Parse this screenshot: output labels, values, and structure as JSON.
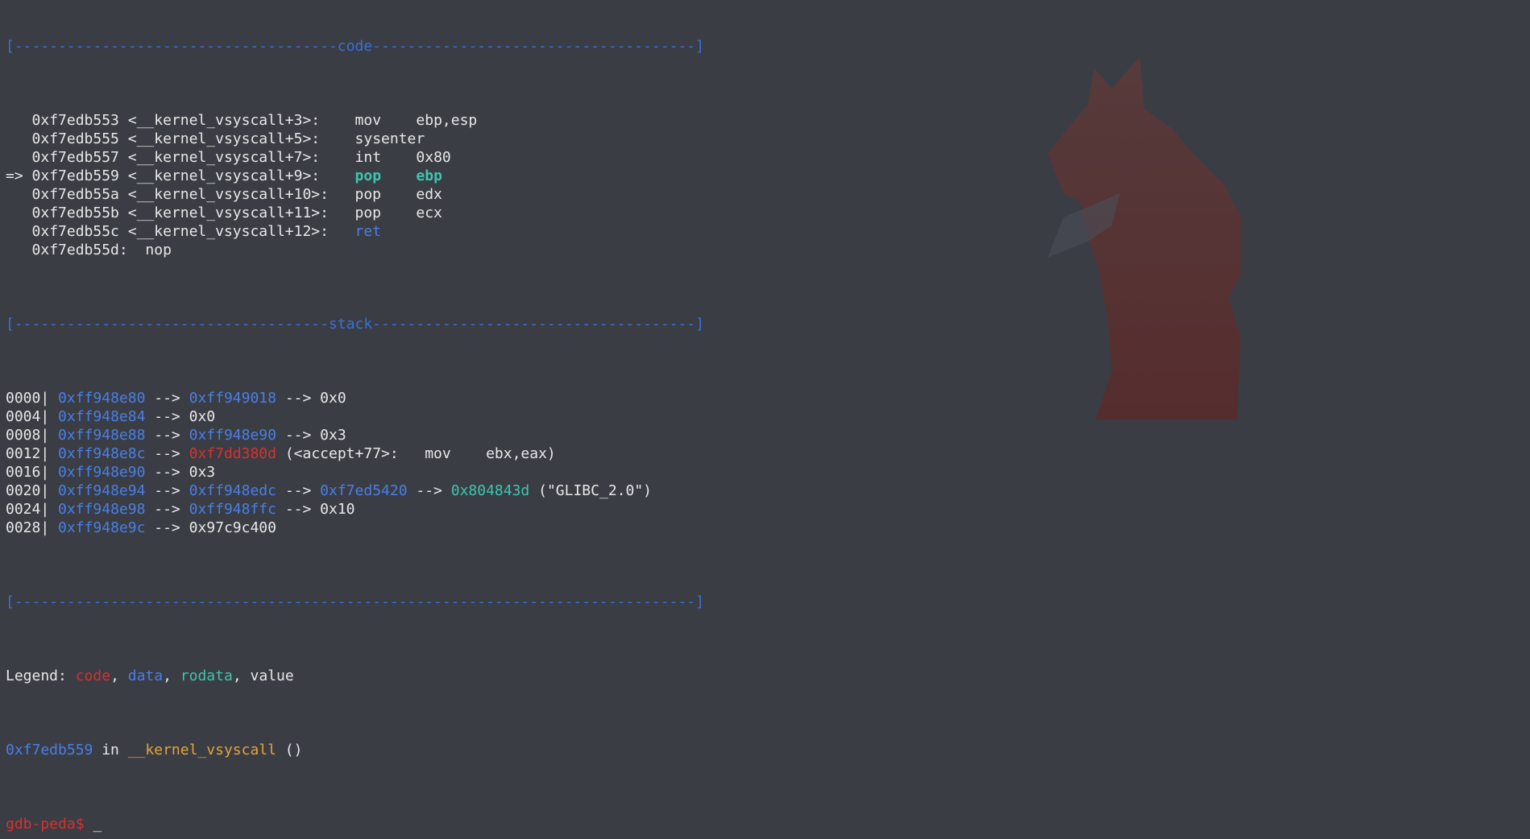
{
  "colors": {
    "code": "#d8312f",
    "data": "#4a7fe6",
    "rodata": "#3ec6b0",
    "value": "#e8e8e8",
    "separator": "#3b6fd8",
    "function": "#e6a43a",
    "background": "#3a3d44"
  },
  "wallpaper": {
    "icon": "fox-silhouette-icon"
  },
  "code_section": {
    "header": "[-------------------------------------code-------------------------------------]",
    "lines": [
      {
        "arrow": "   ",
        "addr": "0xf7edb553",
        "sym": "<__kernel_vsyscall+3>:",
        "pad": "    ",
        "mnemonic": "mov",
        "gap": "    ",
        "operands": "ebp,esp"
      },
      {
        "arrow": "   ",
        "addr": "0xf7edb555",
        "sym": "<__kernel_vsyscall+5>:",
        "pad": "    ",
        "mnemonic": "sysenter",
        "gap": "",
        "operands": ""
      },
      {
        "arrow": "   ",
        "addr": "0xf7edb557",
        "sym": "<__kernel_vsyscall+7>:",
        "pad": "    ",
        "mnemonic": "int",
        "gap": "    ",
        "operands": "0x80"
      },
      {
        "arrow": "=> ",
        "addr": "0xf7edb559",
        "sym": "<__kernel_vsyscall+9>:",
        "pad": "    ",
        "mnemonic": "pop",
        "gap": "    ",
        "operands": "ebp"
      },
      {
        "arrow": "   ",
        "addr": "0xf7edb55a",
        "sym": "<__kernel_vsyscall+10>:",
        "pad": "   ",
        "mnemonic": "pop",
        "gap": "    ",
        "operands": "edx"
      },
      {
        "arrow": "   ",
        "addr": "0xf7edb55b",
        "sym": "<__kernel_vsyscall+11>:",
        "pad": "   ",
        "mnemonic": "pop",
        "gap": "    ",
        "operands": "ecx"
      },
      {
        "arrow": "   ",
        "addr": "0xf7edb55c",
        "sym": "<__kernel_vsyscall+12>:",
        "pad": "   ",
        "mnemonic": "ret",
        "gap": "",
        "operands": ""
      },
      {
        "arrow": "   ",
        "addr": "0xf7edb55d:",
        "sym": "",
        "pad": "  ",
        "mnemonic": "nop",
        "gap": "",
        "operands": ""
      }
    ]
  },
  "stack_section": {
    "header": "[------------------------------------stack-------------------------------------]",
    "rows": [
      {
        "off": "0000",
        "addr": "0xff948e80",
        "p1": "0xff949018",
        "p1c": "blue",
        "rest": " --> 0x0",
        "extra": ""
      },
      {
        "off": "0004",
        "addr": "0xff948e84",
        "p1": "0x0",
        "p1c": "plain",
        "rest": "",
        "extra": ""
      },
      {
        "off": "0008",
        "addr": "0xff948e88",
        "p1": "0xff948e90",
        "p1c": "blue",
        "rest": " --> 0x3",
        "extra": ""
      },
      {
        "off": "0012",
        "addr": "0xff948e8c",
        "p1": "0xf7dd380d",
        "p1c": "red",
        "rest": " (<accept+77>:   mov    ebx,eax)",
        "extra": ""
      },
      {
        "off": "0016",
        "addr": "0xff948e90",
        "p1": "0x3",
        "p1c": "plain",
        "rest": "",
        "extra": ""
      },
      {
        "off": "0020",
        "addr": "0xff948e94",
        "p1": "0xff948edc",
        "p1c": "blue",
        "rest": "",
        "extra": "chain20"
      },
      {
        "off": "0024",
        "addr": "0xff948e98",
        "p1": "0xff948ffc",
        "p1c": "blue",
        "rest": " --> 0x10",
        "extra": ""
      },
      {
        "off": "0028",
        "addr": "0xff948e9c",
        "p1": "0x97c9c400",
        "p1c": "plain",
        "rest": "",
        "extra": ""
      }
    ],
    "chain20": {
      "arrow1": " --> ",
      "p2": "0xf7ed5420",
      "arrow2": " --> ",
      "p3": "0x804843d",
      "str": " (\"GLIBC_2.0\")"
    }
  },
  "footer_separator": "[------------------------------------------------------------------------------]",
  "legend": {
    "prefix": "Legend: ",
    "code": "code",
    "data": "data",
    "rodata": "rodata",
    "value": "value",
    "comma": ", "
  },
  "location": {
    "addr": "0xf7edb559",
    "in": " in ",
    "func": "__kernel_vsyscall",
    "parens": " ()"
  },
  "prompt": {
    "text": "gdb-peda$",
    "cursor": " _"
  }
}
